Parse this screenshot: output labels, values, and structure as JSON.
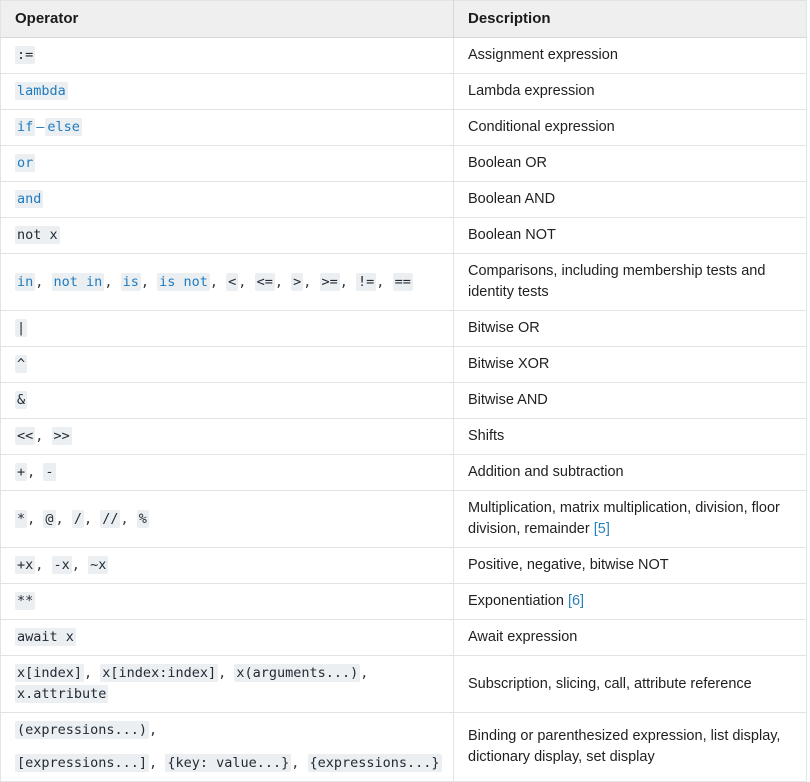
{
  "table": {
    "columns": [
      {
        "key": "operator",
        "label": "Operator"
      },
      {
        "key": "description",
        "label": "Description"
      }
    ],
    "colors": {
      "header_background": "#efefef",
      "border": "#e1e4e5",
      "code_background": "#eceff1",
      "keyword": "#1f7bbf",
      "code_text": "#222b35",
      "body_text": "#1f1f1f",
      "link": "#2980b9"
    },
    "rows": [
      {
        "operator_text": ":=",
        "description": "Assignment expression",
        "tokens": [
          {
            "text": ":=",
            "kind": "code"
          }
        ]
      },
      {
        "operator_text": "lambda",
        "description": "Lambda expression",
        "tokens": [
          {
            "text": "lambda",
            "kind": "keyword"
          }
        ]
      },
      {
        "operator_text": "if – else",
        "description": "Conditional expression",
        "tokens": [
          {
            "text": "if",
            "kind": "keyword"
          },
          {
            "text": "–",
            "kind": "dash"
          },
          {
            "text": "else",
            "kind": "keyword"
          }
        ]
      },
      {
        "operator_text": "or",
        "description": "Boolean OR",
        "tokens": [
          {
            "text": "or",
            "kind": "keyword"
          }
        ]
      },
      {
        "operator_text": "and",
        "description": "Boolean AND",
        "tokens": [
          {
            "text": "and",
            "kind": "keyword"
          }
        ]
      },
      {
        "operator_text": "not x",
        "description": "Boolean NOT",
        "tokens": [
          {
            "text": "not x",
            "kind": "keyword-then-plain",
            "keyword": "not",
            "plain": " x"
          }
        ]
      },
      {
        "operator_text": "in, not in, is, is not, <, <=, >, >=, !=, ==",
        "description": "Comparisons, including membership tests and identity tests",
        "tokens": [
          {
            "text": "in",
            "kind": "keyword"
          },
          {
            "text": ", ",
            "kind": "sep"
          },
          {
            "text": "not in",
            "kind": "keyword"
          },
          {
            "text": ", ",
            "kind": "sep"
          },
          {
            "text": "is",
            "kind": "keyword"
          },
          {
            "text": ", ",
            "kind": "sep"
          },
          {
            "text": "is not",
            "kind": "keyword"
          },
          {
            "text": ", ",
            "kind": "sep"
          },
          {
            "text": "<",
            "kind": "code"
          },
          {
            "text": ", ",
            "kind": "sep"
          },
          {
            "text": "<=",
            "kind": "code"
          },
          {
            "text": ", ",
            "kind": "sep"
          },
          {
            "text": ">",
            "kind": "code"
          },
          {
            "text": ", ",
            "kind": "sep"
          },
          {
            "text": ">=",
            "kind": "code"
          },
          {
            "text": ", ",
            "kind": "sep"
          },
          {
            "text": "!=",
            "kind": "code"
          },
          {
            "text": ", ",
            "kind": "sep"
          },
          {
            "text": "==",
            "kind": "code"
          }
        ]
      },
      {
        "operator_text": "|",
        "description": "Bitwise OR",
        "tokens": [
          {
            "text": "|",
            "kind": "code"
          }
        ]
      },
      {
        "operator_text": "^",
        "description": "Bitwise XOR",
        "tokens": [
          {
            "text": "^",
            "kind": "code"
          }
        ]
      },
      {
        "operator_text": "&",
        "description": "Bitwise AND",
        "tokens": [
          {
            "text": "&",
            "kind": "code"
          }
        ]
      },
      {
        "operator_text": "<<, >>",
        "description": "Shifts",
        "tokens": [
          {
            "text": "<<",
            "kind": "code"
          },
          {
            "text": ", ",
            "kind": "sep"
          },
          {
            "text": ">>",
            "kind": "code"
          }
        ]
      },
      {
        "operator_text": "+, -",
        "description": "Addition and subtraction",
        "tokens": [
          {
            "text": "+",
            "kind": "code"
          },
          {
            "text": ", ",
            "kind": "sep"
          },
          {
            "text": "-",
            "kind": "code"
          }
        ]
      },
      {
        "operator_text": "*, @, /, //, %",
        "description": "Multiplication, matrix multiplication, division, floor division, remainder",
        "footnote": "[5]",
        "tokens": [
          {
            "text": "*",
            "kind": "code"
          },
          {
            "text": ", ",
            "kind": "sep"
          },
          {
            "text": "@",
            "kind": "code"
          },
          {
            "text": ", ",
            "kind": "sep"
          },
          {
            "text": "/",
            "kind": "code"
          },
          {
            "text": ", ",
            "kind": "sep"
          },
          {
            "text": "//",
            "kind": "code"
          },
          {
            "text": ", ",
            "kind": "sep"
          },
          {
            "text": "%",
            "kind": "code"
          }
        ]
      },
      {
        "operator_text": "+x, -x, ~x",
        "description": "Positive, negative, bitwise NOT",
        "tokens": [
          {
            "text": "+x",
            "kind": "code"
          },
          {
            "text": ", ",
            "kind": "sep"
          },
          {
            "text": "-x",
            "kind": "code"
          },
          {
            "text": ", ",
            "kind": "sep"
          },
          {
            "text": "~x",
            "kind": "code"
          }
        ]
      },
      {
        "operator_text": "**",
        "description": "Exponentiation",
        "footnote": "[6]",
        "tokens": [
          {
            "text": "**",
            "kind": "code"
          }
        ]
      },
      {
        "operator_text": "await x",
        "description": "Await expression",
        "tokens": [
          {
            "text": "await x",
            "kind": "keyword-then-plain",
            "keyword": "await",
            "plain": " x"
          }
        ]
      },
      {
        "operator_text": "x[index], x[index:index], x(arguments...), x.attribute",
        "description": "Subscription, slicing, call, attribute reference",
        "tokens": [
          {
            "text": "x[index]",
            "kind": "code"
          },
          {
            "text": ", ",
            "kind": "sep"
          },
          {
            "text": "x[index:index]",
            "kind": "code"
          },
          {
            "text": ", ",
            "kind": "sep"
          },
          {
            "text": "x(arguments...)",
            "kind": "code"
          },
          {
            "text": ", ",
            "kind": "sep"
          },
          {
            "text": "x.attribute",
            "kind": "code"
          }
        ]
      },
      {
        "operator_text": "(expressions...), [expressions...], {key: value...}, {expressions...}",
        "description": "Binding or parenthesized expression, list display, dictionary display, set display",
        "two_line": true,
        "tokens_line1": [
          {
            "text": "(expressions...)",
            "kind": "code"
          },
          {
            "text": ",",
            "kind": "sep"
          }
        ],
        "tokens_line2": [
          {
            "text": "[expressions...]",
            "kind": "code"
          },
          {
            "text": ", ",
            "kind": "sep"
          },
          {
            "text": "{key: value...}",
            "kind": "code"
          },
          {
            "text": ", ",
            "kind": "sep"
          },
          {
            "text": "{expressions...}",
            "kind": "code"
          }
        ]
      }
    ]
  }
}
